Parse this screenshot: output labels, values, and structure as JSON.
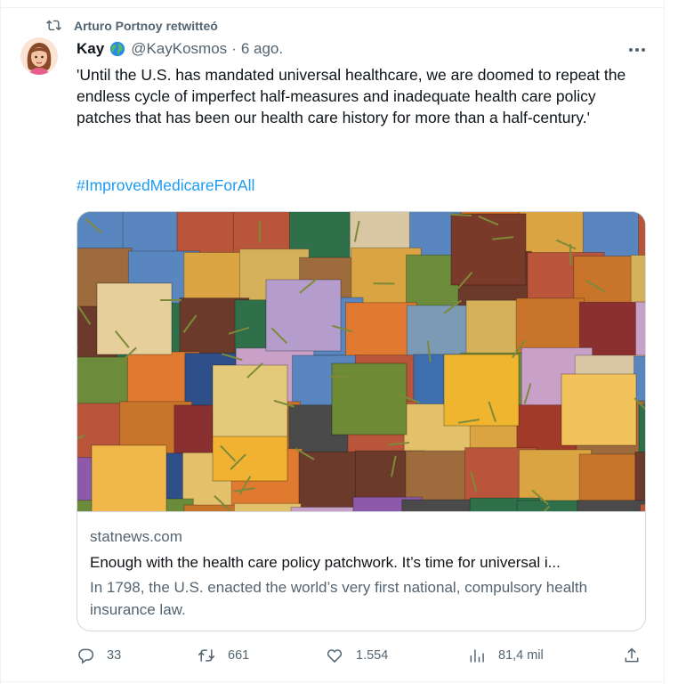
{
  "retweet": {
    "label": "Arturo Portnoy retwitteó"
  },
  "author": {
    "name": "Kay",
    "handle": "@KayKosmos",
    "separator": "·",
    "date": "6 ago."
  },
  "tweet": {
    "text": "'Until the U.S. has mandated universal healthcare, we are doomed to repeat the endless cycle of imperfect half-measures and inadequate health care policy patches that has been our health care history for more than a half-century.'",
    "hashtag": "#ImprovedMedicareForAll"
  },
  "card": {
    "domain": "statnews.com",
    "title": "Enough with the health care policy patchwork. It’s time for universal i...",
    "description": "In 1798, the U.S. enacted the world’s very first national, compulsory health insurance law."
  },
  "actions": {
    "replies": "33",
    "retweets": "661",
    "likes": "1.554",
    "views": "81,4 mil"
  },
  "icons": [
    "retweet-icon",
    "globe-icon",
    "more-icon",
    "reply-icon",
    "like-icon",
    "views-icon",
    "share-icon"
  ],
  "colors": {
    "link": "#1d9bf0",
    "secondary": "#536471",
    "text": "#0f1419",
    "border": "#cfd9de"
  }
}
